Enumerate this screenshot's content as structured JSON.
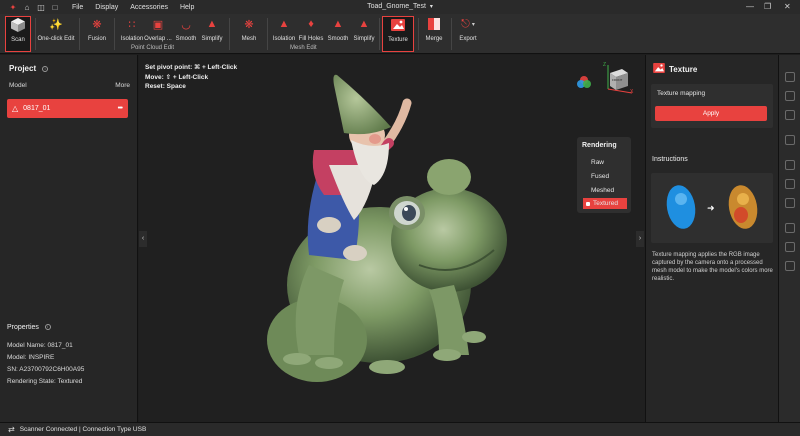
{
  "titlebar": {
    "menus": [
      "File",
      "Display",
      "Accessories",
      "Help"
    ],
    "document_title": "Toad_Gnome_Test",
    "icons": [
      "app-logo-icon",
      "home-icon",
      "import-icon",
      "folder-icon"
    ]
  },
  "toolbar": {
    "scan": "Scan",
    "one_click_edit": "One-click Edit",
    "fusion": "Fusion",
    "isolation": "Isolation",
    "overlap": "Overlap ...",
    "smooth": "Smooth",
    "simplify": "Simplify",
    "point_cloud_edit": "Point Cloud Edit",
    "mesh": "Mesh",
    "mesh_isolation": "Isolation",
    "fill_holes": "Fill Holes",
    "mesh_smooth": "Smooth",
    "mesh_simplify": "Simplify",
    "mesh_edit": "Mesh Edit",
    "texture": "Texture",
    "merge": "Merge",
    "export": "Export"
  },
  "project": {
    "heading": "Project",
    "col_model": "Model",
    "col_more": "More",
    "item_name": "0817_01",
    "item_more": "•••"
  },
  "properties": {
    "heading": "Properties",
    "model_name": "Model Name:  0817_01",
    "model": "Model:  INSPIRE",
    "sn": "SN:  A23700792C6H00A95",
    "rendering_state": "Rendering State:  Textured"
  },
  "viewport": {
    "hint_pivot": "Set pivot point: ⌘ + Left-Click",
    "hint_move": "Move: ⇧ + Left-Click",
    "hint_reset": "Reset: Space",
    "cube_face": "FRONT",
    "axis_x": "X",
    "axis_z": "Z"
  },
  "rendering": {
    "heading": "Rendering",
    "options": [
      "Raw",
      "Fused",
      "Meshed",
      "Textured"
    ],
    "selected": "Textured"
  },
  "texture_panel": {
    "heading": "Texture",
    "mapping_label": "Texture mapping",
    "apply": "Apply",
    "instructions_heading": "Instructions",
    "instructions_text": "Texture mapping applies the RGB image captured by the camera onto a processed mesh model to make the model's colors more realistic."
  },
  "statusbar": {
    "text": "Scanner Connected | Connection Type USB"
  },
  "colors": {
    "accent": "#e8423f",
    "panel": "#262626",
    "viewport": "#202020"
  }
}
